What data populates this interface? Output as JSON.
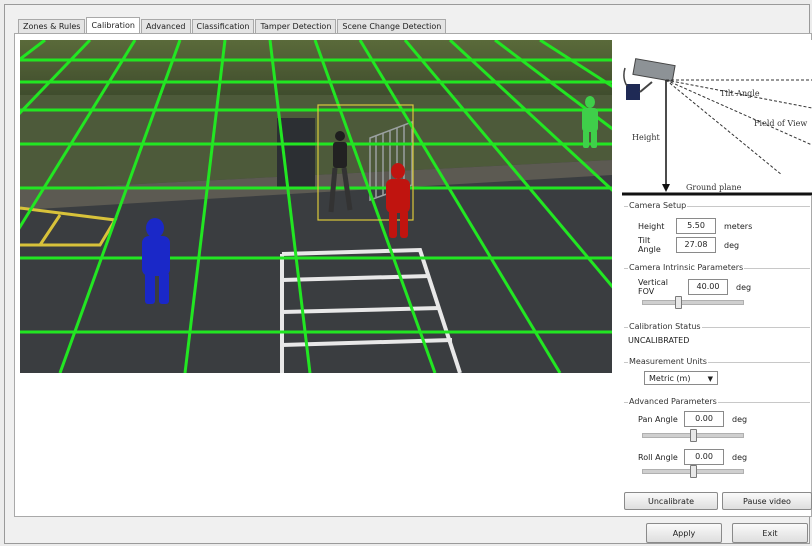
{
  "tabs": [
    {
      "label": "Zones & Rules"
    },
    {
      "label": "Calibration"
    },
    {
      "label": "Advanced"
    },
    {
      "label": "Classification"
    },
    {
      "label": "Tamper Detection"
    },
    {
      "label": "Scene Change Detection"
    }
  ],
  "diagram": {
    "tilt_label": "Tilt Angle",
    "fov_label": "Field of View",
    "height_label": "Height",
    "ground_label": "Ground plane"
  },
  "camera_setup": {
    "title": "Camera Setup",
    "height_label": "Height",
    "height_value": "5.50",
    "height_unit": "meters",
    "tilt_label": "Tilt Angle",
    "tilt_value": "27.08",
    "tilt_unit": "deg"
  },
  "intrinsic": {
    "title": "Camera Intrinsic Parameters",
    "fov_label": "Vertical FOV",
    "fov_value": "40.00",
    "fov_unit": "deg",
    "fov_slider": 0.35
  },
  "status": {
    "title": "Calibration Status",
    "value": "UNCALIBRATED"
  },
  "units": {
    "title": "Measurement Units",
    "selected": "Metric (m)"
  },
  "advanced": {
    "title": "Advanced Parameters",
    "pan_label": "Pan Angle",
    "pan_value": "0.00",
    "pan_unit": "deg",
    "pan_slider": 0.5,
    "roll_label": "Roll Angle",
    "roll_value": "0.00",
    "roll_unit": "deg",
    "roll_slider": 0.5
  },
  "buttons": {
    "uncalibrate": "Uncalibrate",
    "pause_video": "Pause video",
    "apply": "Apply",
    "exit": "Exit"
  },
  "colors": {
    "grid": "#22e622",
    "figure_red": "#c0140f",
    "figure_blue": "#1a28c8",
    "figure_green": "#3fcf4a",
    "selection_box": "#d9c93a"
  }
}
